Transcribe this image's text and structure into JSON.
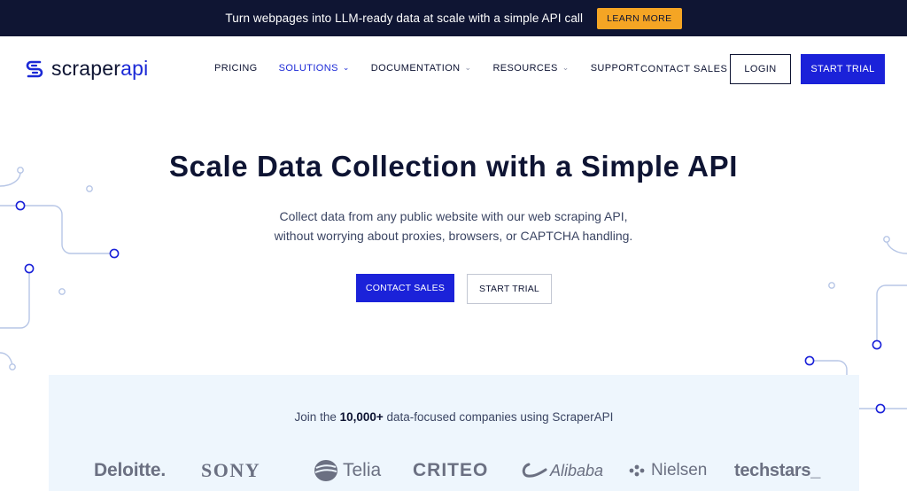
{
  "announcement": {
    "text": "Turn webpages into LLM-ready data at scale with a simple API call",
    "button_label": "LEARN MORE"
  },
  "header": {
    "logo_text_main": "scraper",
    "logo_text_accent": "api",
    "nav": [
      {
        "label": "PRICING",
        "dropdown": false
      },
      {
        "label": "SOLUTIONS",
        "dropdown": true,
        "active": true
      },
      {
        "label": "DOCUMENTATION",
        "dropdown": true
      },
      {
        "label": "RESOURCES",
        "dropdown": true
      },
      {
        "label": "SUPPORT",
        "dropdown": false
      }
    ],
    "contact_sales": "CONTACT SALES",
    "login": "LOGIN",
    "start_trial": "START TRIAL"
  },
  "hero": {
    "title": "Scale Data Collection with a Simple API",
    "subtitle_line1": "Collect data from any public website with our web scraping API,",
    "subtitle_line2": "without worrying about proxies, browsers, or CAPTCHA handling.",
    "contact_sales": "CONTACT SALES",
    "start_trial": "START TRIAL"
  },
  "trusted": {
    "prefix": "Join the ",
    "count": "10,000+",
    "suffix": " data-focused companies using ScraperAPI",
    "logos": [
      "Deloitte.",
      "SONY",
      "Telia",
      "CRITEO",
      "Alibaba",
      "Nielsen",
      "techstars_"
    ]
  },
  "colors": {
    "navy": "#0f1533",
    "accent_blue": "#1b22d9",
    "announce_button": "#f5a524",
    "band_background": "#eef6fd"
  }
}
